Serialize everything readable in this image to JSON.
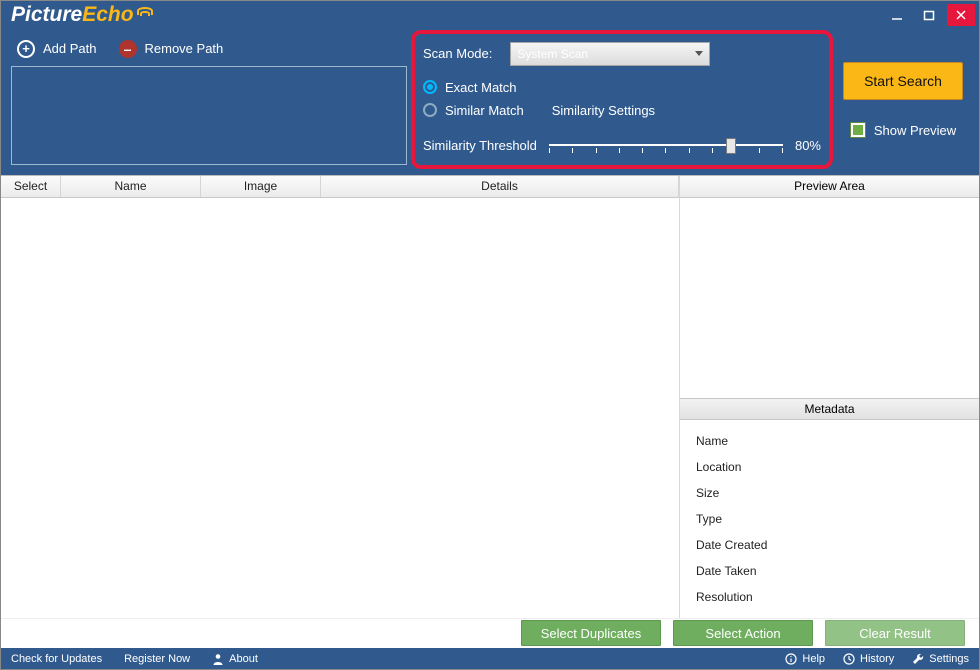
{
  "app": {
    "name1": "Picture",
    "name2": "Echo"
  },
  "toolbar": {
    "add_path": "Add Path",
    "remove_path": "Remove Path"
  },
  "scan": {
    "mode_label": "Scan Mode:",
    "mode_value": "System Scan",
    "exact_label": "Exact Match",
    "similar_label": "Similar Match",
    "similarity_settings": "Similarity Settings",
    "threshold_label": "Similarity Threshold",
    "threshold_value": "80%"
  },
  "actions": {
    "start": "Start Search",
    "show_preview": "Show Preview",
    "select_duplicates": "Select Duplicates",
    "select_action": "Select Action",
    "clear_result": "Clear Result"
  },
  "columns": {
    "select": "Select",
    "name": "Name",
    "image": "Image",
    "details": "Details",
    "preview_area": "Preview Area",
    "metadata": "Metadata"
  },
  "metadata_fields": {
    "name": "Name",
    "location": "Location",
    "size": "Size",
    "type": "Type",
    "date_created": "Date Created",
    "date_taken": "Date Taken",
    "resolution": "Resolution"
  },
  "status": {
    "check_updates": "Check for Updates",
    "register": "Register Now",
    "about": "About",
    "help": "Help",
    "history": "History",
    "settings": "Settings"
  }
}
